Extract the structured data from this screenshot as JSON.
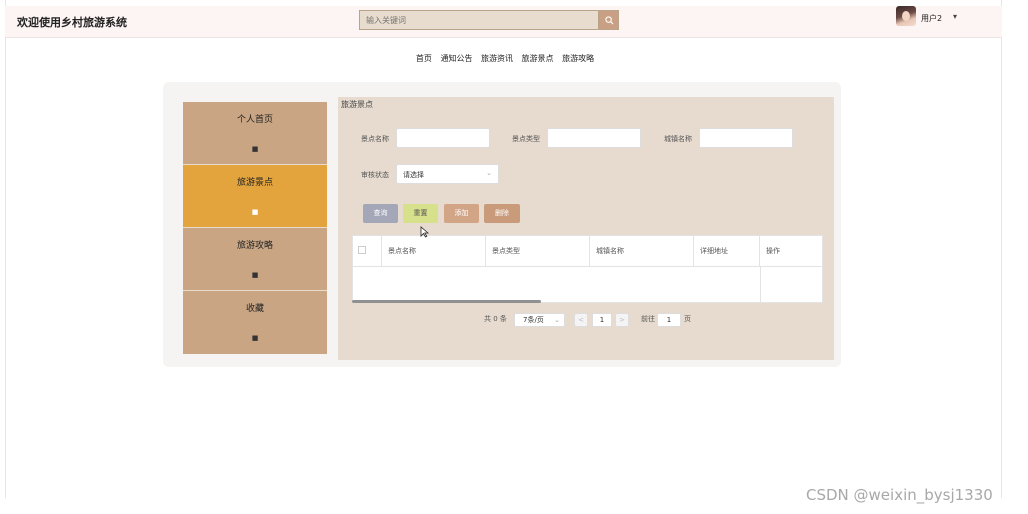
{
  "header": {
    "site_title": "欢迎使用乡村旅游系统",
    "search_placeholder": "输入关键词",
    "user_name": "用户2",
    "user_caret": "▾"
  },
  "nav": {
    "items": [
      "首页",
      "通知公告",
      "旅游资讯",
      "旅游景点",
      "旅游攻略"
    ]
  },
  "sidebar": {
    "items": [
      {
        "label": "个人首页",
        "icon": "■"
      },
      {
        "label": "旅游景点",
        "icon": "■"
      },
      {
        "label": "旅游攻略",
        "icon": "■"
      },
      {
        "label": "收藏",
        "icon": "■"
      }
    ]
  },
  "main": {
    "title": "旅游景点",
    "filters": {
      "name_label": "景点名称",
      "type_label": "景点类型",
      "city_label": "城镇名称",
      "status_label": "审核状态",
      "status_value": "请选择",
      "status_caret": "⌄"
    },
    "buttons": {
      "query": "查询",
      "reset": "重置",
      "add": "添加",
      "delete": "删除"
    },
    "table": {
      "columns": [
        "景点名称",
        "景点类型",
        "城镇名称",
        "详细地址",
        "操作"
      ]
    },
    "pagination": {
      "total": "共 0 条",
      "page_size": "7条/页",
      "page_size_caret": "⌄",
      "prev": "<",
      "current": "1",
      "next": ">",
      "goto_label": "前往",
      "goto_value": "1",
      "page_unit": "页"
    }
  },
  "watermark": "CSDN @weixin_bysj1330",
  "colors": {
    "sidebar": "#c9a584",
    "sidebar_active": "#e3a43e",
    "content_bg": "#e6dbce",
    "btn_query": "#a3a7b8",
    "btn_reset": "#d7e08a",
    "btn_add": "#d2a587",
    "btn_delete": "#c99b7b"
  }
}
